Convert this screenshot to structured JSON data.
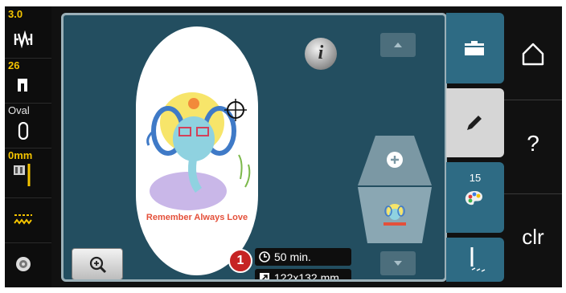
{
  "left_panel": {
    "stitch_width": "3.0",
    "presser_foot": "26",
    "hoop_label": "Oval",
    "needle_position": "0mm"
  },
  "main": {
    "info_button_label": "i",
    "design_text": "Remember Always Love",
    "status": {
      "time": "50 min.",
      "size": "122x132 mm"
    },
    "marker": "1"
  },
  "right_tabs": {
    "color_count": "15"
  },
  "system_buttons": {
    "help_label": "?",
    "clear_label": "clr"
  },
  "colors": {
    "accent_yellow": "#f4c400",
    "panel_blue": "#234e60",
    "tab_blue": "#2e6b84",
    "marker_red": "#c62424"
  },
  "icons": [
    "stitch-width-icon",
    "presser-foot-icon",
    "hoop-icon",
    "needle-icon",
    "feed-dog-icon",
    "bobbin-icon",
    "zoom-in-icon",
    "clock-icon",
    "resize-icon",
    "add-icon",
    "folder-icon",
    "pencil-icon",
    "palette-icon",
    "needle-stitch-icon",
    "home-icon"
  ]
}
